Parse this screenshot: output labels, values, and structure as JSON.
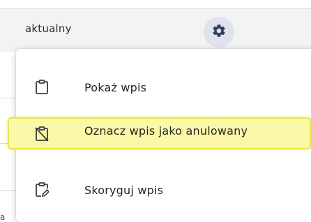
{
  "row": {
    "status_text": "aktualny",
    "gear_icon": "gear-icon"
  },
  "partial_text": "a",
  "menu": {
    "items": [
      {
        "label": "Pokaż wpis",
        "icon": "clipboard-icon",
        "highlighted": false
      },
      {
        "label": "Oznacz wpis jako anulowany",
        "icon": "clipboard-off-icon",
        "highlighted": true
      },
      {
        "label": "Skoryguj wpis",
        "icon": "clipboard-edit-icon",
        "highlighted": false
      }
    ]
  },
  "colors": {
    "highlight_fill": "#fbf8a8",
    "highlight_border": "#e6e64d",
    "gear_background": "#dfe3ec",
    "gear_color": "#2f3e5c"
  }
}
